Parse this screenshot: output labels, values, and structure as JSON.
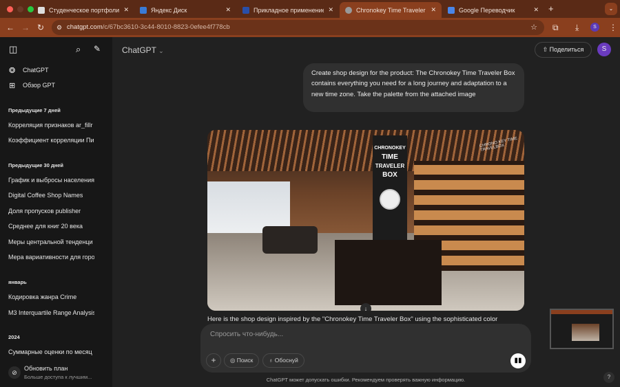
{
  "browser": {
    "tabs": [
      {
        "title": "Студенческое портфолио / >",
        "active": false
      },
      {
        "title": "Яндекс Диск",
        "active": false
      },
      {
        "title": "Прикладное применение ге",
        "active": false
      },
      {
        "title": "Chronokey Time Traveler Box",
        "active": true
      },
      {
        "title": "Google Переводчик",
        "active": false
      }
    ],
    "new_tab": "+",
    "url_host": "chatgpt.com",
    "url_path": "/c/67bc3610-3c44-8010-8823-0efee4f778cb",
    "profile": "S"
  },
  "sidebar": {
    "top": [
      {
        "label": "ChatGPT"
      },
      {
        "label": "Обзор GPT"
      }
    ],
    "sections": [
      {
        "title": "Предыдущие 7 дней",
        "items": [
          "Корреляция признаков ar_fillr",
          "Коэффициент корреляции Пи"
        ]
      },
      {
        "title": "Предыдущие 30 дней",
        "items": [
          "График и выбросы населения",
          "Digital Coffee Shop Names",
          "Доля пропусков publisher",
          "Среднее для книг 20 века",
          "Меры центральной тенденци",
          "Мера вариативности для горо"
        ]
      },
      {
        "title": "январь",
        "items": [
          "Кодировка жанра Crime",
          "M3 Interquartile Range Analysis"
        ]
      },
      {
        "title": "2024",
        "items": [
          "Суммарные оценки по месяц"
        ]
      }
    ],
    "upgrade": {
      "title": "Обновить план",
      "subtitle": "Больше доступа к лучшим..."
    }
  },
  "header": {
    "model": "ChatGPT",
    "share": "Поделиться",
    "avatar": "S"
  },
  "chat": {
    "user_message": "Create shop design for the product: The Chronokey Time Traveler Box contains everything you need for a long journey and adaptation to a new time zone. Take the palette from the attached image",
    "image_sign": [
      "CHRONOKEY",
      "TIME",
      "TRAVELER",
      "BOX"
    ],
    "image_wall_sign": "CHRONO KEY TIME TRAVELBOX",
    "reply": "Here is the shop design inspired by the \"Chronokey Time Traveler Box\" using the sophisticated color"
  },
  "composer": {
    "placeholder": "Спросить что-нибудь...",
    "search": "Поиск",
    "reason": "Обоснуй"
  },
  "footer": "ChatGPT может допускать ошибки. Рекомендуем проверять важную информацию.",
  "help": "?"
}
